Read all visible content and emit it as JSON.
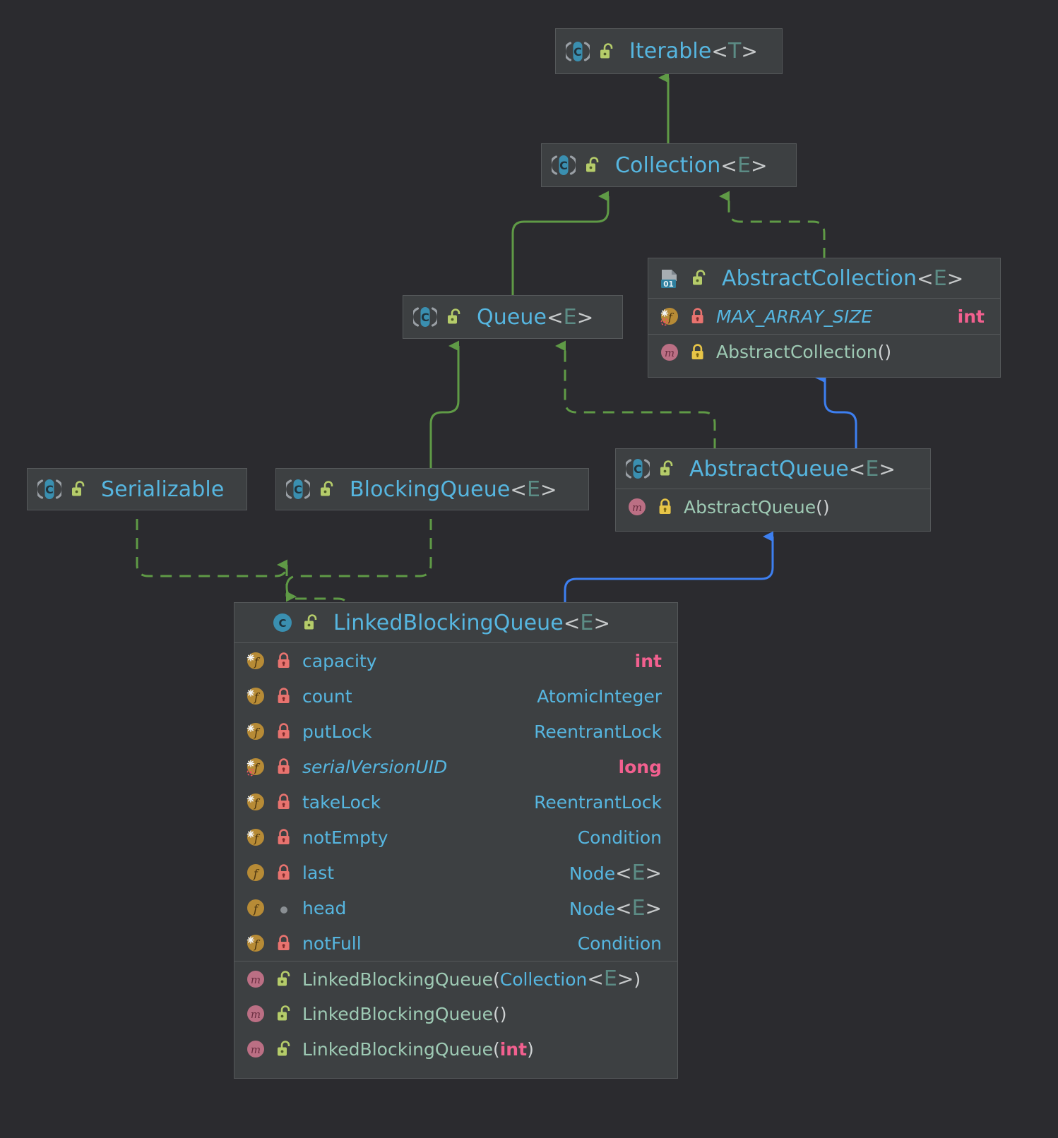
{
  "diagram": {
    "title": "LinkedBlockingQueue class hierarchy",
    "background": "#2b2b2f",
    "node_fill": "#3d4042",
    "node_border": "#55585a",
    "colors": {
      "type_name": "#56b6e0",
      "generic_param": "#5c8c85",
      "keyword_type": "#f2608f",
      "method_name": "#9ecab4",
      "inherit_edge_green": "#6d9e4f",
      "extends_edge_blue": "#3d7ff0",
      "lock_public": "#b5cc6a",
      "lock_private": "#e8736f",
      "lock_protected": "#e8c547"
    }
  },
  "nodes": [
    {
      "id": "iterable",
      "name": "Iterable",
      "generic": "T",
      "kind": "interface",
      "icon": "interface-icon",
      "visibility_icon": "unlock-green-icon",
      "fields": [],
      "methods": []
    },
    {
      "id": "collection",
      "name": "Collection",
      "generic": "E",
      "kind": "interface",
      "icon": "interface-icon",
      "visibility_icon": "unlock-green-icon",
      "fields": [],
      "methods": []
    },
    {
      "id": "abstractcollection",
      "name": "AbstractCollection",
      "generic": "E",
      "kind": "abstract-class",
      "icon": "abstract-class-icon",
      "visibility_icon": "unlock-green-icon",
      "fields": [
        {
          "name": "MAX_ARRAY_SIZE",
          "type": "int",
          "type_is_keyword": true,
          "italic": true,
          "icon": "field-static-final-icon",
          "visibility_icon": "lock-private-icon"
        }
      ],
      "methods": [
        {
          "name": "AbstractCollection",
          "params": "",
          "icon": "method-icon",
          "visibility_icon": "lock-protected-icon"
        }
      ]
    },
    {
      "id": "queue",
      "name": "Queue",
      "generic": "E",
      "kind": "interface",
      "icon": "interface-icon",
      "visibility_icon": "unlock-green-icon",
      "fields": [],
      "methods": []
    },
    {
      "id": "abstractqueue",
      "name": "AbstractQueue",
      "generic": "E",
      "kind": "abstract-class",
      "icon": "interface-icon",
      "visibility_icon": "unlock-green-icon",
      "fields": [],
      "methods": [
        {
          "name": "AbstractQueue",
          "params": "",
          "icon": "method-icon",
          "visibility_icon": "lock-protected-icon"
        }
      ]
    },
    {
      "id": "serializable",
      "name": "Serializable",
      "generic": "",
      "kind": "interface",
      "icon": "interface-icon",
      "visibility_icon": "unlock-green-icon",
      "fields": [],
      "methods": []
    },
    {
      "id": "blockingqueue",
      "name": "BlockingQueue",
      "generic": "E",
      "kind": "interface",
      "icon": "interface-icon",
      "visibility_icon": "unlock-green-icon",
      "fields": [],
      "methods": []
    },
    {
      "id": "linkedblockingqueue",
      "name": "LinkedBlockingQueue",
      "generic": "E",
      "kind": "class",
      "icon": "class-icon",
      "visibility_icon": "unlock-green-icon",
      "fields": [
        {
          "name": "capacity",
          "type": "int",
          "type_is_keyword": true,
          "italic": false,
          "icon": "field-final-icon",
          "visibility_icon": "lock-private-icon"
        },
        {
          "name": "count",
          "type": "AtomicInteger",
          "type_is_keyword": false,
          "italic": false,
          "icon": "field-final-icon",
          "visibility_icon": "lock-private-icon"
        },
        {
          "name": "putLock",
          "type": "ReentrantLock",
          "type_is_keyword": false,
          "italic": false,
          "icon": "field-final-icon",
          "visibility_icon": "lock-private-icon"
        },
        {
          "name": "serialVersionUID",
          "type": "long",
          "type_is_keyword": true,
          "italic": true,
          "icon": "field-static-final-icon",
          "visibility_icon": "lock-private-icon"
        },
        {
          "name": "takeLock",
          "type": "ReentrantLock",
          "type_is_keyword": false,
          "italic": false,
          "icon": "field-final-icon",
          "visibility_icon": "lock-private-icon"
        },
        {
          "name": "notEmpty",
          "type": "Condition",
          "type_is_keyword": false,
          "italic": false,
          "icon": "field-final-icon",
          "visibility_icon": "lock-private-icon"
        },
        {
          "name": "last",
          "type": "Node<E>",
          "type_is_keyword": false,
          "italic": false,
          "icon": "field-icon",
          "visibility_icon": "lock-private-icon"
        },
        {
          "name": "head",
          "type": "Node<E>",
          "type_is_keyword": false,
          "italic": false,
          "icon": "field-icon",
          "visibility_icon": "dot-package-icon"
        },
        {
          "name": "notFull",
          "type": "Condition",
          "type_is_keyword": false,
          "italic": false,
          "icon": "field-final-icon",
          "visibility_icon": "lock-private-icon"
        }
      ],
      "methods": [
        {
          "name": "LinkedBlockingQueue",
          "params": "Collection<E>",
          "param_is_keyword": false,
          "icon": "method-icon",
          "visibility_icon": "unlock-green-icon"
        },
        {
          "name": "LinkedBlockingQueue",
          "params": "",
          "param_is_keyword": false,
          "icon": "method-icon",
          "visibility_icon": "unlock-green-icon"
        },
        {
          "name": "LinkedBlockingQueue",
          "params": "int",
          "param_is_keyword": true,
          "icon": "method-icon",
          "visibility_icon": "unlock-green-icon"
        }
      ]
    }
  ],
  "edges": [
    {
      "from": "collection",
      "to": "iterable",
      "style": "solid",
      "color": "#6d9e4f",
      "relation": "extends"
    },
    {
      "from": "queue",
      "to": "collection",
      "style": "solid",
      "color": "#6d9e4f",
      "relation": "extends"
    },
    {
      "from": "abstractcollection",
      "to": "collection",
      "style": "dashed",
      "color": "#6d9e4f",
      "relation": "implements"
    },
    {
      "from": "blockingqueue",
      "to": "queue",
      "style": "solid",
      "color": "#6d9e4f",
      "relation": "extends"
    },
    {
      "from": "abstractqueue",
      "to": "queue",
      "style": "dashed",
      "color": "#6d9e4f",
      "relation": "implements"
    },
    {
      "from": "abstractqueue",
      "to": "abstractcollection",
      "style": "solid",
      "color": "#3d7ff0",
      "relation": "extends"
    },
    {
      "from": "linkedblockingqueue",
      "to": "serializable",
      "style": "dashed",
      "color": "#6d9e4f",
      "relation": "implements"
    },
    {
      "from": "linkedblockingqueue",
      "to": "blockingqueue",
      "style": "dashed",
      "color": "#6d9e4f",
      "relation": "implements"
    },
    {
      "from": "linkedblockingqueue",
      "to": "abstractqueue",
      "style": "solid",
      "color": "#3d7ff0",
      "relation": "extends"
    }
  ]
}
